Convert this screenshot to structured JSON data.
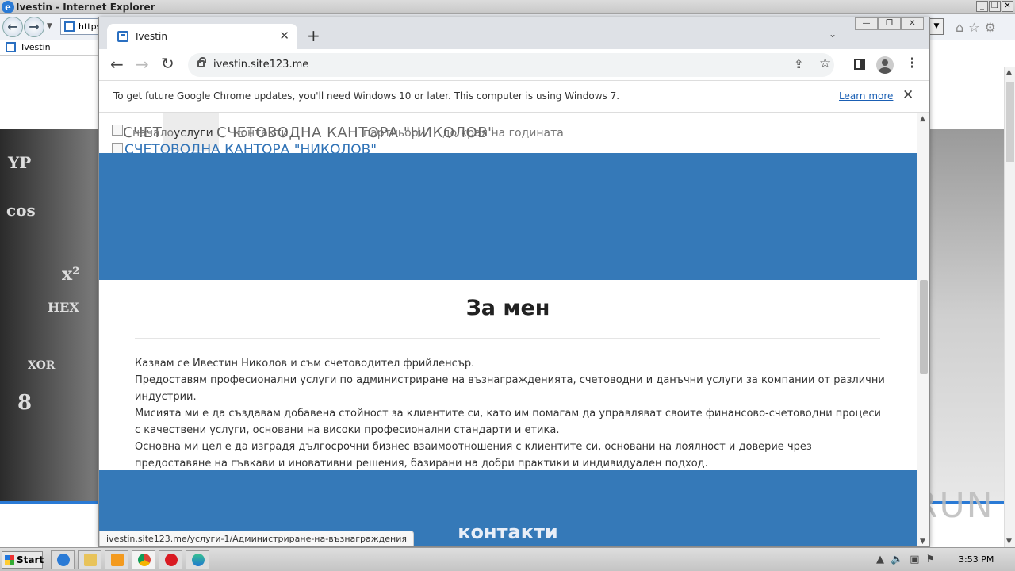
{
  "ie": {
    "title": "Ivestin - Internet Explorer",
    "address": "https",
    "tab_label": "Ivestin"
  },
  "chrome": {
    "tab_title": "Ivestin",
    "url": "ivestin.site123.me",
    "info_message": "To get future Google Chrome updates, you'll need Windows 10 or later. This computer is using Windows 7.",
    "learn_more": "Learn more"
  },
  "site": {
    "brand": "СЧЕТОВОДНА КАНТОРА \"НИКОЛОВ\"",
    "brand_overlap": "СЧЕТ",
    "nav": [
      {
        "label": "начало"
      },
      {
        "label": "услуги"
      },
      {
        "label": "контакти"
      },
      {
        "label": "партньори"
      },
      {
        "label": "до края на годината"
      }
    ],
    "about_title": "За мен",
    "about_paragraphs": [
      "Казвам се Ивестин Николов и съм счетоводител фрийленсър.",
      "Предоставям професионални услуги по администриране на възнагражденията, счетоводни и данъчни услуги за компании от различни индустрии.",
      "Мисията ми е да създавам добавена стойност за клиентите си, като им помагам да управляват своите финансово-счетоводни процеси с качествени услуги, основани на високи професионални стандарти и етика.",
      "Основна ми цел е да изградя дългосрочни бизнес взаимоотношения с клиентите си, основани на лоялност и доверие чрез предоставяне на гъвкави и иновативни решения, базирани на добри практики и индивидуален подход."
    ],
    "contact_title": "контакти",
    "status_url": "ivestin.site123.me/услуги-1/Администриране-на-възнаграждения"
  },
  "taskbar": {
    "start": "Start",
    "clock": "3:53 PM"
  },
  "watermark": "ANY RUN",
  "colors": {
    "site_blue": "#3579b8",
    "link_blue": "#1a5fb4"
  }
}
